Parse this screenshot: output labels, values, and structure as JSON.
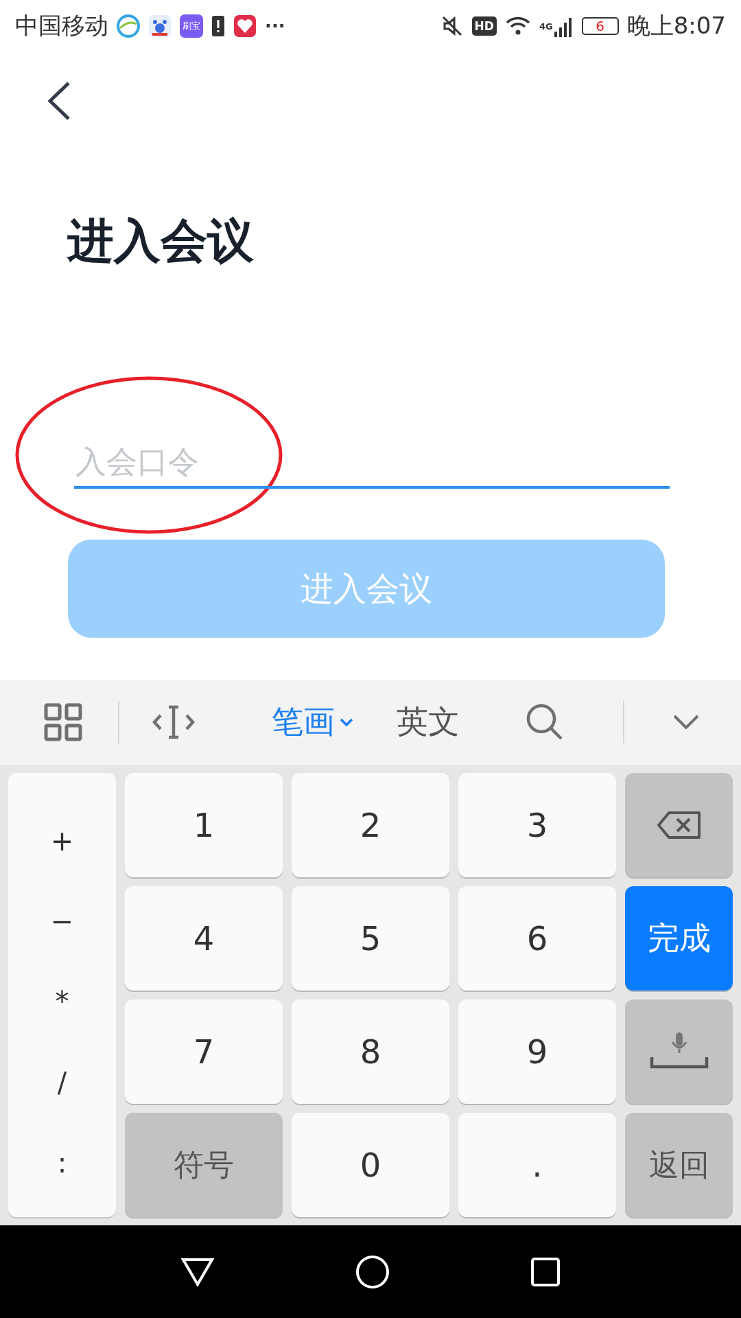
{
  "status_bar": {
    "carrier": "中国移动",
    "app_badge": "刷宝",
    "overflow": "···",
    "hd": "HD",
    "network": "4G",
    "battery": "6",
    "time": "晚上8:07"
  },
  "title": "进入会议",
  "passcode_field": {
    "placeholder": "入会口令"
  },
  "join_button": {
    "label": "进入会议",
    "disabled": true
  },
  "keyboard": {
    "toolbar_modes": [
      {
        "label": "笔画",
        "selected": true
      },
      {
        "label": "英文",
        "selected": false
      }
    ],
    "symbols": [
      "+",
      "−",
      "*",
      "/",
      ":"
    ],
    "keys": [
      {
        "kind": "digit",
        "label": "1"
      },
      {
        "kind": "digit",
        "label": "2"
      },
      {
        "kind": "digit",
        "label": "3"
      },
      {
        "kind": "backspace"
      },
      {
        "kind": "digit",
        "label": "4"
      },
      {
        "kind": "digit",
        "label": "5"
      },
      {
        "kind": "digit",
        "label": "6"
      },
      {
        "kind": "done",
        "label": "完成"
      },
      {
        "kind": "digit",
        "label": "7"
      },
      {
        "kind": "digit",
        "label": "8"
      },
      {
        "kind": "digit",
        "label": "9"
      },
      {
        "kind": "voice"
      },
      {
        "kind": "function",
        "label": "符号"
      },
      {
        "kind": "digit",
        "label": "0"
      },
      {
        "kind": "digit",
        "label": "."
      },
      {
        "kind": "function",
        "label": "返回"
      }
    ]
  }
}
